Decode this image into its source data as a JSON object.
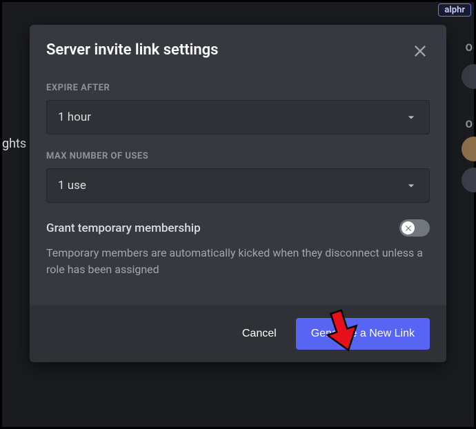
{
  "badge": "alphr",
  "bg_fragment": "ghts",
  "edge_letters": {
    "top": "O",
    "bottom": "O"
  },
  "modal": {
    "title": "Server invite link settings",
    "expire": {
      "label": "Expire after",
      "value": "1 hour"
    },
    "max_uses": {
      "label": "Max number of uses",
      "value": "1 use"
    },
    "temp_membership": {
      "label": "Grant temporary membership",
      "help": "Temporary members are automatically kicked when they disconnect unless a role has been assigned",
      "state": "off"
    },
    "footer": {
      "cancel": "Cancel",
      "generate": "Generate a New Link"
    }
  }
}
